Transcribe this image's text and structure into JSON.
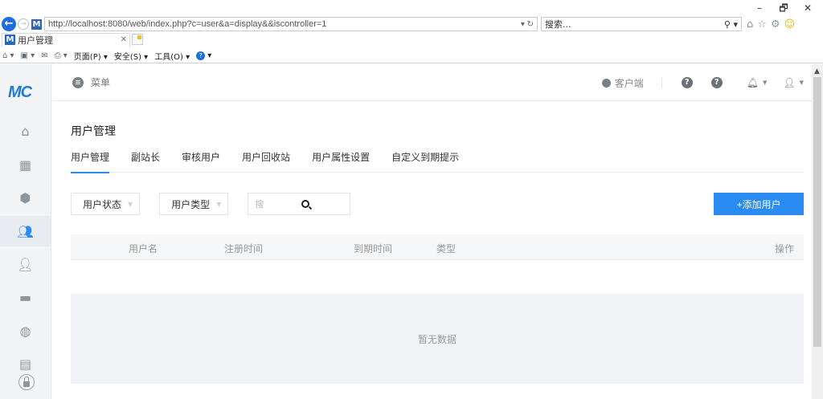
{
  "browser": {
    "url": "http://localhost:8080/web/index.php?c=user&a=display&&iscontroller=1",
    "search_placeholder": "搜索...",
    "tab_title": "用户管理",
    "favicon_letter": "M",
    "commands": {
      "page": "页面(P)",
      "safety": "安全(S)",
      "tools": "工具(O)"
    },
    "window_buttons": {
      "minimize": "–",
      "restore": "🗗",
      "close": "✕"
    }
  },
  "app": {
    "logo": "MC",
    "sidebar": [
      {
        "name": "home",
        "icon": "house-icon",
        "active": false
      },
      {
        "name": "apps",
        "icon": "grid-icon",
        "active": false
      },
      {
        "name": "modules",
        "icon": "box-gear-icon",
        "active": false
      },
      {
        "name": "users",
        "icon": "users-icon",
        "active": true
      },
      {
        "name": "permissions",
        "icon": "user-lock-icon",
        "active": false
      },
      {
        "name": "display",
        "icon": "monitor-icon",
        "active": false
      },
      {
        "name": "sites",
        "icon": "globe-icon",
        "active": false
      },
      {
        "name": "store",
        "icon": "store-icon",
        "active": false
      }
    ],
    "topbar": {
      "menu_label": "菜单",
      "client_label": "客户端",
      "help1": "?",
      "help2": "?"
    },
    "page_title": "用户管理",
    "tabs": [
      "用户管理",
      "副站长",
      "审核用户",
      "用户回收站",
      "用户属性设置",
      "自定义到期提示"
    ],
    "active_tab": 0,
    "filters": {
      "status_label": "用户状态",
      "type_label": "用户类型",
      "search_placeholder": "搜"
    },
    "add_button": "+添加用户",
    "table": {
      "columns": [
        "用户名",
        "注册时间",
        "到期时间",
        "类型",
        "操作"
      ]
    },
    "empty_text": "暂无数据"
  },
  "colors": {
    "accent": "#2a8cf0",
    "logo": "#1e7be0"
  }
}
